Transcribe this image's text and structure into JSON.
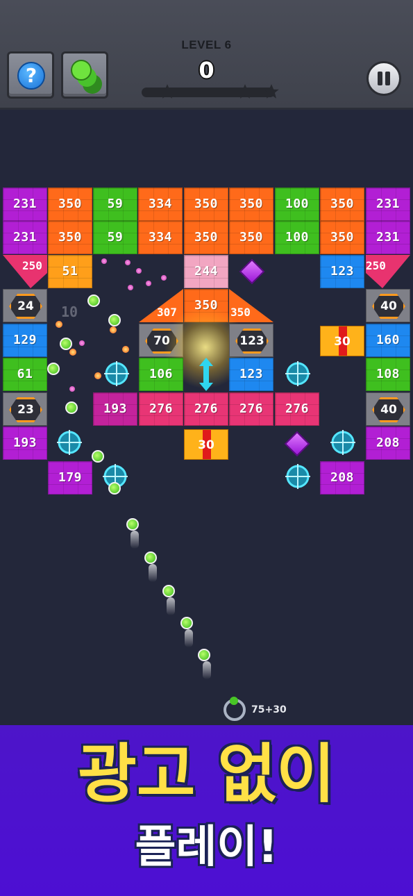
{
  "hud": {
    "level_label": "LEVEL 6",
    "score": "0",
    "help_symbol": "?",
    "stars_filled": 0,
    "stars_total": 3
  },
  "field": {
    "bricks": [
      {
        "value": "231",
        "color": "#b21fd4"
      },
      {
        "value": "350",
        "color": "#ff6a1a"
      },
      {
        "value": "59",
        "color": "#3fbf1f"
      },
      {
        "value": "334",
        "color": "#ff6a1a"
      },
      {
        "value": "350",
        "color": "#ff6a1a"
      },
      {
        "value": "350",
        "color": "#ff6a1a"
      },
      {
        "value": "100",
        "color": "#3fbf1f"
      },
      {
        "value": "350",
        "color": "#ff6a1a"
      },
      {
        "value": "231",
        "color": "#b21fd4"
      },
      {
        "value": "231",
        "color": "#b21fd4"
      },
      {
        "value": "350",
        "color": "#ff6a1a"
      },
      {
        "value": "59",
        "color": "#3fbf1f"
      },
      {
        "value": "334",
        "color": "#ff6a1a"
      },
      {
        "value": "350",
        "color": "#ff6a1a"
      },
      {
        "value": "350",
        "color": "#ff6a1a"
      },
      {
        "value": "100",
        "color": "#3fbf1f"
      },
      {
        "value": "350",
        "color": "#ff6a1a"
      },
      {
        "value": "231",
        "color": "#b21fd4"
      },
      {
        "value": "51",
        "color": "#ff9f1a"
      },
      {
        "value": "244",
        "color": "#f2a6c2"
      },
      {
        "value": "123",
        "color": "#1e88f0"
      },
      {
        "value": "350",
        "color": "#ff6a1a"
      },
      {
        "value": "129",
        "color": "#1e88f0"
      },
      {
        "value": "160",
        "color": "#1e88f0"
      },
      {
        "value": "61",
        "color": "#3fbf1f"
      },
      {
        "value": "106",
        "color": "#3fbf1f"
      },
      {
        "value": "123",
        "color": "#1e88f0"
      },
      {
        "value": "108",
        "color": "#3fbf1f"
      },
      {
        "value": "193",
        "color": "#c4239c"
      },
      {
        "value": "276",
        "color": "#e83575"
      },
      {
        "value": "276",
        "color": "#e83575"
      },
      {
        "value": "276",
        "color": "#e83575"
      },
      {
        "value": "276",
        "color": "#e83575"
      },
      {
        "value": "193",
        "color": "#b21fd4"
      },
      {
        "value": "208",
        "color": "#b21fd4"
      },
      {
        "value": "179",
        "color": "#b21fd4"
      },
      {
        "value": "208",
        "color": "#b21fd4"
      }
    ],
    "triangles": [
      "250",
      "250",
      "307",
      "350"
    ],
    "shields": [
      "24",
      "40",
      "70",
      "123",
      "23",
      "40"
    ],
    "gifts": [
      "30",
      "30"
    ],
    "ghost_number": "10",
    "ball_count_label": "75+30"
  },
  "banner": {
    "line1": "광고 없이",
    "line2": "플레이!"
  }
}
